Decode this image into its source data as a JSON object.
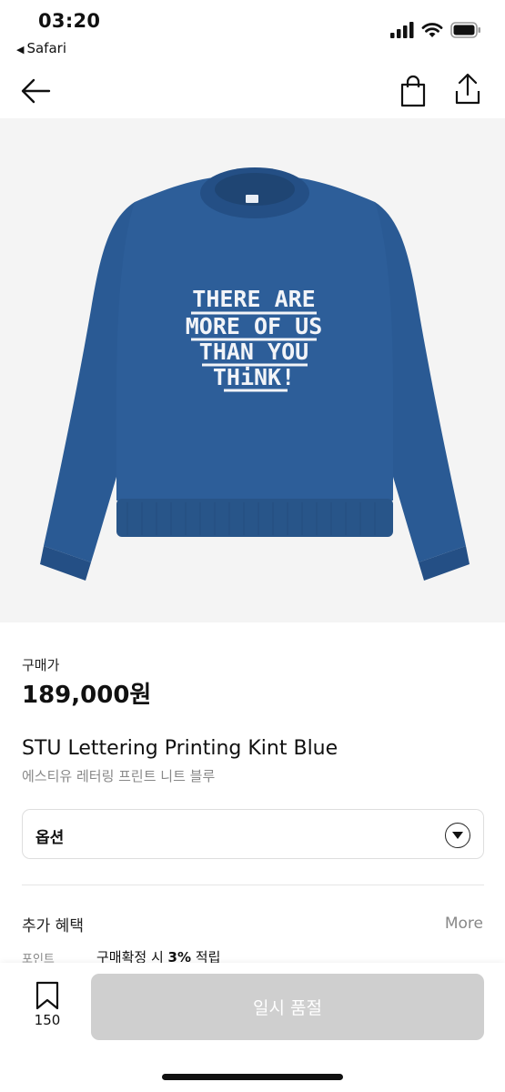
{
  "status_bar": {
    "time": "03:20",
    "back_app": "Safari"
  },
  "product": {
    "image": {
      "print_lines": [
        "THERE ARE",
        "MORE OF US",
        "THAN YOU",
        "THiNK!"
      ],
      "sweater_color": "#2a5a94",
      "text_color": "#f2f4f8",
      "background": "#f4f4f4"
    },
    "price_label": "구매가",
    "price": "189,000원",
    "title": "STU Lettering Printing Kint Blue",
    "subtitle": "에스티유 레터링 프린트 니트 블루",
    "option_label": "옵션"
  },
  "benefits": {
    "title": "추가 혜택",
    "more": "More",
    "point_label": "포인트",
    "point_text_prefix": "구매확정 시 ",
    "point_percent": "3%",
    "point_text_suffix": " 적립"
  },
  "bottom_bar": {
    "bookmark_count": "150",
    "button_label": "일시 품절"
  },
  "icons": {
    "back": "arrow-left-icon",
    "bag": "shopping-bag-icon",
    "share": "share-icon",
    "bookmark": "bookmark-icon"
  }
}
